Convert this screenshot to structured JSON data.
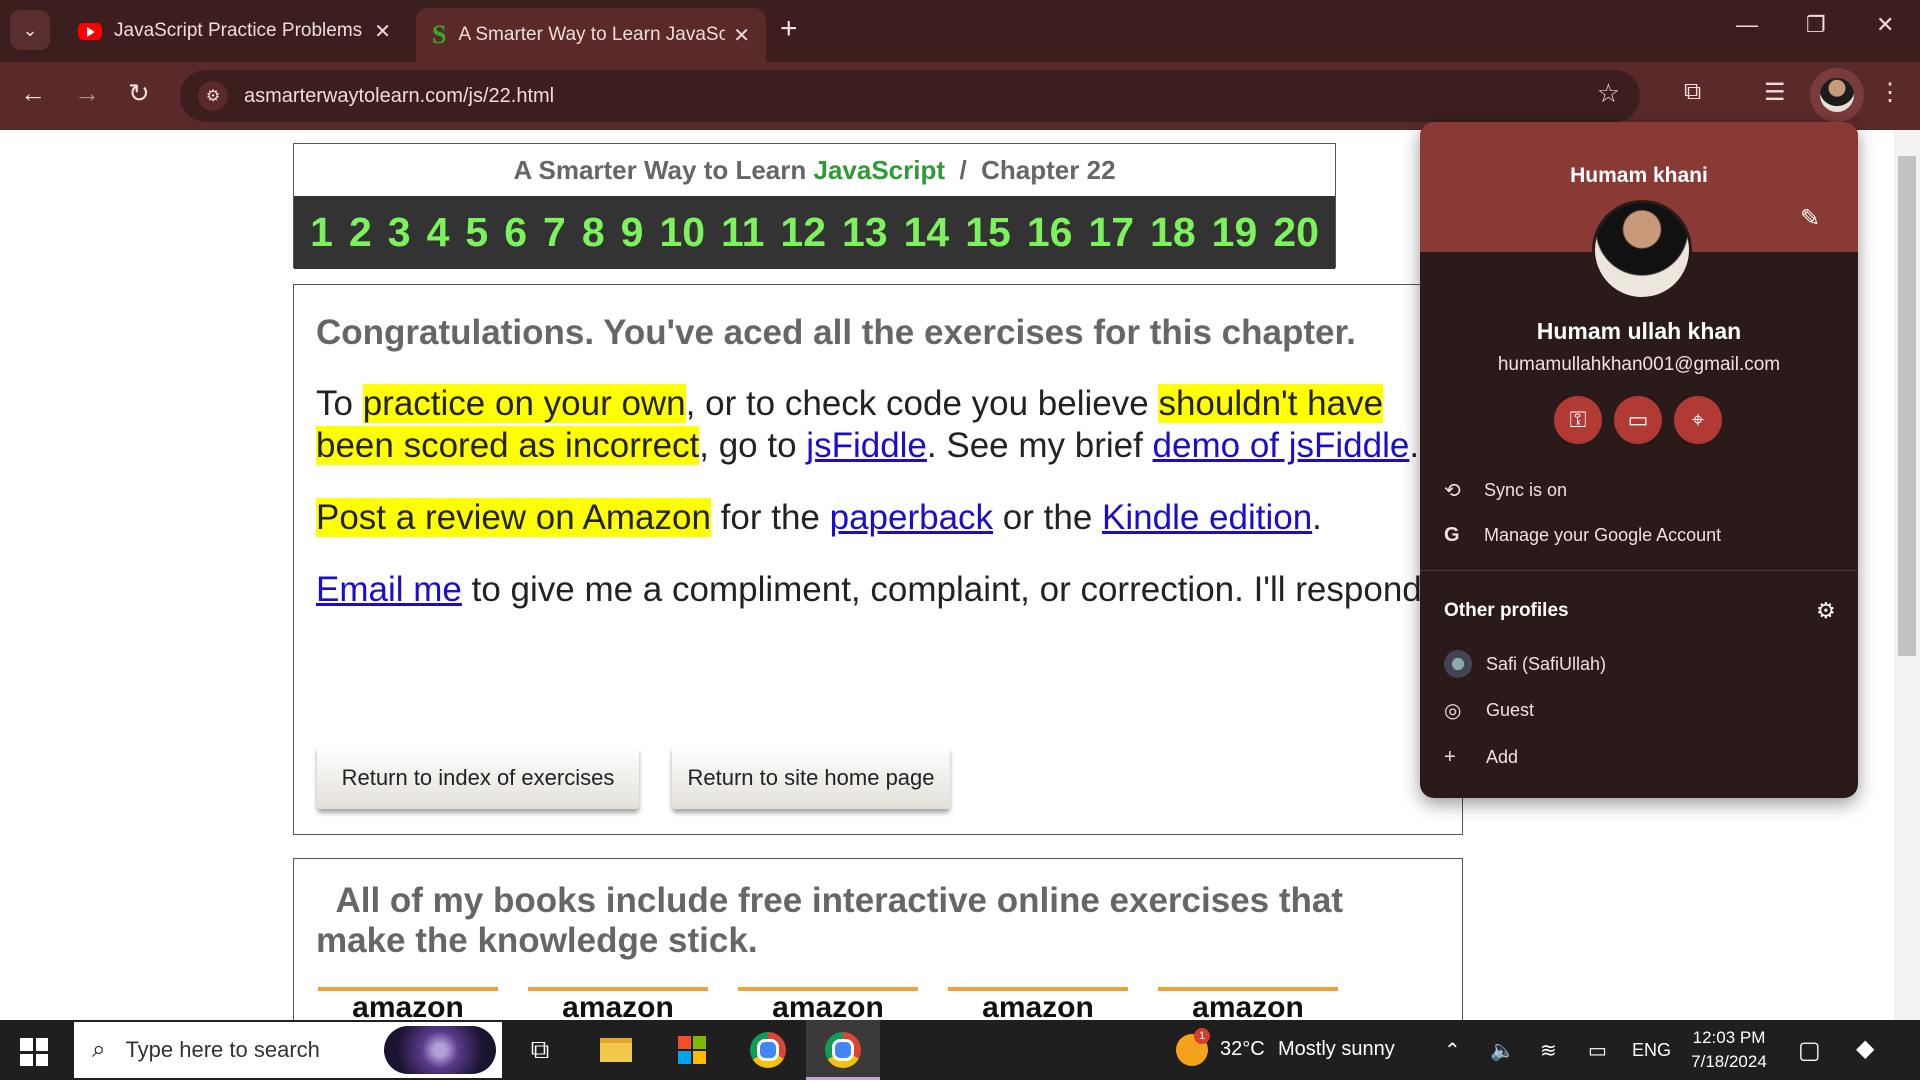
{
  "browser": {
    "tabs": [
      {
        "title": "JavaScript Practice Problems | P",
        "icon": "youtube-icon"
      },
      {
        "title": "A Smarter Way to Learn JavaScr",
        "icon": "site-s-icon"
      }
    ],
    "url": "asmarterwaytolearn.com/js/22.html"
  },
  "page": {
    "header": {
      "prefix": "A Smarter Way to Learn ",
      "js": "JavaScript",
      "suffix": "  /  Chapter 22"
    },
    "chapters": [
      "1",
      "2",
      "3",
      "4",
      "5",
      "6",
      "7",
      "8",
      "9",
      "10",
      "11",
      "12",
      "13",
      "14",
      "15",
      "16",
      "17",
      "18",
      "19",
      "20"
    ],
    "congrats": "Congratulations. You've aced all the exercises for this chapter.",
    "p1": {
      "a": "To ",
      "hl1": "practice on your own",
      "b": ", or to check code you believe ",
      "hl2": "shouldn't have been scored as incorrect",
      "c": ", go to ",
      "link1": "jsFiddle",
      "d": ". See my brief ",
      "link2": "demo of jsFiddle",
      "e": "."
    },
    "p2": {
      "hl": "Post a review on Amazon",
      "a": " for the ",
      "link1": "paperback",
      "b": " or the ",
      "link2": "Kindle edition",
      "c": "."
    },
    "p3": {
      "link": "Email me",
      "a": " to give me a compliment, complaint, or correction. I'll respond."
    },
    "buttons": {
      "index": "Return to index of exercises",
      "home": "Return to site home page"
    },
    "books_title": "  All of my books include free interactive online exercises that make the knowledge stick.",
    "amazon_label": "amazon"
  },
  "profile": {
    "header_name": "Humam khani",
    "full_name": "Humam ullah khan",
    "email": "humamullahkhan001@gmail.com",
    "sync": "Sync is on",
    "manage": "Manage your Google Account",
    "other_title": "Other profiles",
    "others": [
      "Safi (SafiUllah)",
      "Guest",
      "Add"
    ]
  },
  "taskbar": {
    "search_placeholder": "Type here to search",
    "weather_temp": "32°C",
    "weather_desc": "Mostly sunny",
    "weather_badge": "1",
    "lang": "ENG",
    "time": "12:03 PM",
    "date": "7/18/2024"
  }
}
